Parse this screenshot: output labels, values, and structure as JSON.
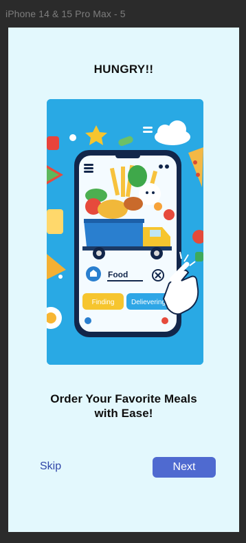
{
  "frame": {
    "label": "iPhone 14 & 15 Pro Max - 5"
  },
  "screen": {
    "title": "HUNGRY!!",
    "tagline_line1": "Order Your Favorite Meals",
    "tagline_line2": "with Ease!"
  },
  "illustration": {
    "search_text": "Food",
    "btn_finding": "Finding",
    "btn_delivering": "Delievering"
  },
  "actions": {
    "skip": "Skip",
    "next": "Next"
  },
  "colors": {
    "background": "#e3f8fd",
    "accent": "#4f6ad0",
    "skip_text": "#3046a8"
  }
}
